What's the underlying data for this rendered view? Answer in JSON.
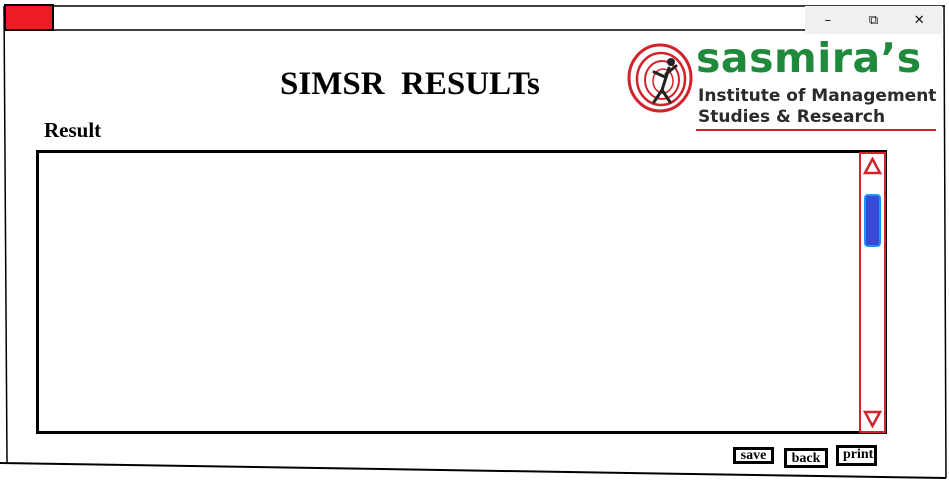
{
  "window": {
    "controls": {
      "minimize": "–",
      "restore": "⧉",
      "close": "✕"
    }
  },
  "header": {
    "title": "SIMSR  RESULTs"
  },
  "logo": {
    "name": "sasmira’s",
    "line1": "Institute of Management",
    "line2": "Studies & Research",
    "colors": {
      "name": "#1f8a3b",
      "accent": "#d2232a"
    }
  },
  "result": {
    "label": "Result",
    "content": ""
  },
  "buttons": {
    "save": "save",
    "back": "back",
    "print": "print"
  },
  "colors": {
    "scrollbar_border": "#d2232a",
    "scroll_thumb": "#3a48d6",
    "corner_block": "#ed1c24"
  }
}
